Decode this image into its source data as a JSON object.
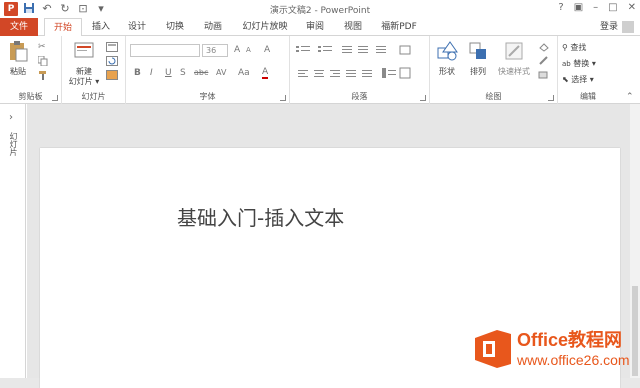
{
  "window": {
    "title": "演示文稿2 - PowerPoint",
    "help_label": "?",
    "minimize_label": "–",
    "restore_label": "□",
    "close_label": "✕"
  },
  "tabs": [
    {
      "label": "文件"
    },
    {
      "label": "开始"
    },
    {
      "label": "插入"
    },
    {
      "label": "设计"
    },
    {
      "label": "切换"
    },
    {
      "label": "动画"
    },
    {
      "label": "幻灯片放映"
    },
    {
      "label": "审阅"
    },
    {
      "label": "视图"
    },
    {
      "label": "福新PDF"
    }
  ],
  "account": {
    "login_label": "登录"
  },
  "ribbon": {
    "clipboard": {
      "label": "剪贴板",
      "paste_label": "粘贴"
    },
    "slides": {
      "label": "幻灯片",
      "new_slide_label": "新建\n幻灯片 ▾",
      "new_slide_line1": "新建",
      "new_slide_line2": "幻灯片 ▾"
    },
    "font": {
      "label": "字体",
      "font_size": "36",
      "bold": "B",
      "italic": "I",
      "underline": "U",
      "shadow": "S",
      "strike": "abc",
      "spacing": "AV",
      "case": "Aa",
      "color": "A"
    },
    "paragraph": {
      "label": "段落"
    },
    "drawing": {
      "label": "绘图",
      "shapes_label": "形状",
      "arrange_label": "排列",
      "quick_styles_label": "快速样式"
    },
    "editing": {
      "label": "编辑",
      "find_label": "查找",
      "replace_label": "替换",
      "select_label": "选择"
    }
  },
  "left_pane": {
    "label": "幻灯片"
  },
  "slide": {
    "title_text": "基础入门-插入文本"
  },
  "watermark": {
    "line1": "Office教程网",
    "line2": "www.office26.com"
  }
}
